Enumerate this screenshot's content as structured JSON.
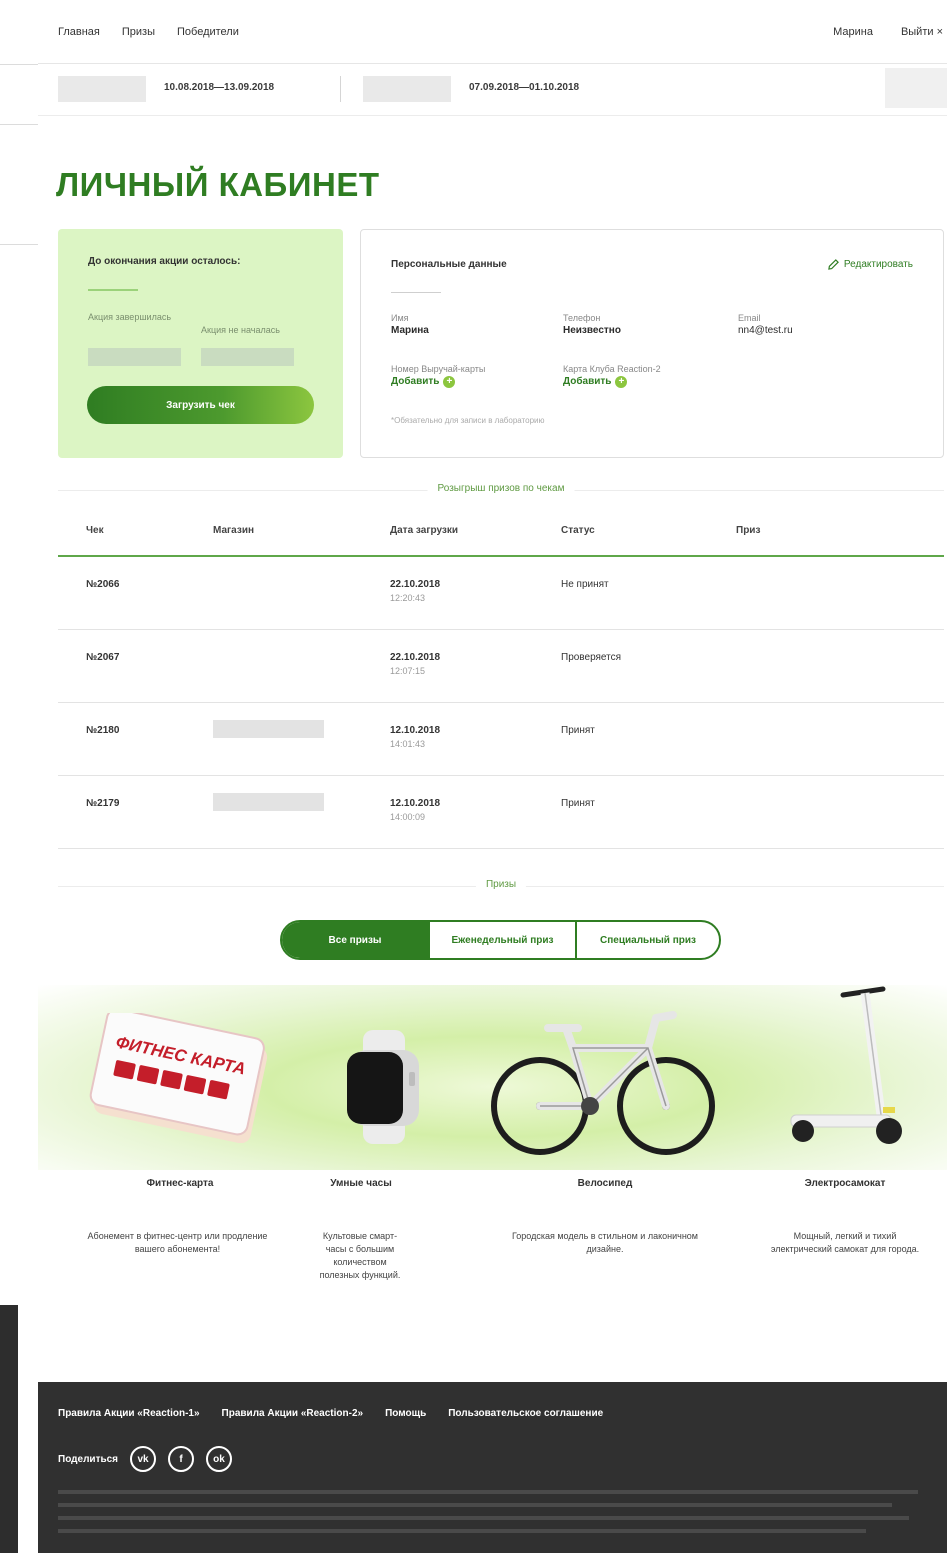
{
  "nav": {
    "links": [
      "Главная",
      "Призы",
      "Победители"
    ],
    "user": "Марина",
    "logout": "Выйти ×"
  },
  "periods": {
    "first_dates": "10.08.2018—13.09.2018",
    "second_dates": "07.09.2018—01.10.2018"
  },
  "page_title": "ЛИЧНЫЙ КАБИНЕТ",
  "promo": {
    "title": "До окончания акции осталось:",
    "label_ended": "Акция завершилась",
    "label_not_started": "Акция не началась",
    "upload_button": "Загрузить чек"
  },
  "personal": {
    "title": "Персональные данные",
    "edit": "Редактировать",
    "fields": {
      "name_label": "Имя",
      "name_value": "Марина",
      "phone_label": "Телефон",
      "phone_value": "Неизвестно",
      "email_label": "Email",
      "email_value": "nn4@test.ru",
      "card1_label": "Номер Выручай-карты",
      "card1_value": "Добавить",
      "card2_label": "Карта Клуба Reaction-2",
      "card2_value": "Добавить"
    },
    "note": "*Обязательно для записи в лабораторию"
  },
  "receipts": {
    "section_label": "Розыгрыш призов по чекам",
    "headers": [
      "Чек",
      "Магазин",
      "Дата загрузки",
      "Статус",
      "Приз"
    ],
    "rows": [
      {
        "num": "№2066",
        "date": "22.10.2018",
        "time": "12:20:43",
        "status": "Не принят"
      },
      {
        "num": "№2067",
        "date": "22.10.2018",
        "time": "12:07:15",
        "status": "Проверяется"
      },
      {
        "num": "№2180",
        "date": "12.10.2018",
        "time": "14:01:43",
        "status": "Принят"
      },
      {
        "num": "№2179",
        "date": "12.10.2018",
        "time": "14:00:09",
        "status": "Принят"
      }
    ]
  },
  "prizes": {
    "section_label": "Призы",
    "tabs": [
      "Все призы",
      "Еженедельный приз",
      "Специальный приз"
    ],
    "items": [
      {
        "name": "Фитнес-карта",
        "desc": "Абонемент в фитнес-центр или продление вашего абонемента!",
        "card_text": "ФИТНЕС КАРТА"
      },
      {
        "name": "Умные часы",
        "desc": "Культовые смарт-часы с большим количеством полезных функций."
      },
      {
        "name": "Велосипед",
        "desc": "Городская модель в стильном и лаконичном дизайне."
      },
      {
        "name": "Электросамокат",
        "desc": "Мощный, легкий и тихий электрический самокат для города."
      }
    ]
  },
  "footer": {
    "links": [
      "Правила Акции «Reaction-1»",
      "Правила Акции «Reaction-2»",
      "Помощь",
      "Пользовательское соглашение"
    ],
    "share": "Поделиться",
    "social": [
      "vk",
      "f",
      "ok"
    ]
  },
  "colors": {
    "brand_green": "#2f7d22",
    "light_green": "#dcf5c4",
    "footer_bg": "#303030"
  }
}
